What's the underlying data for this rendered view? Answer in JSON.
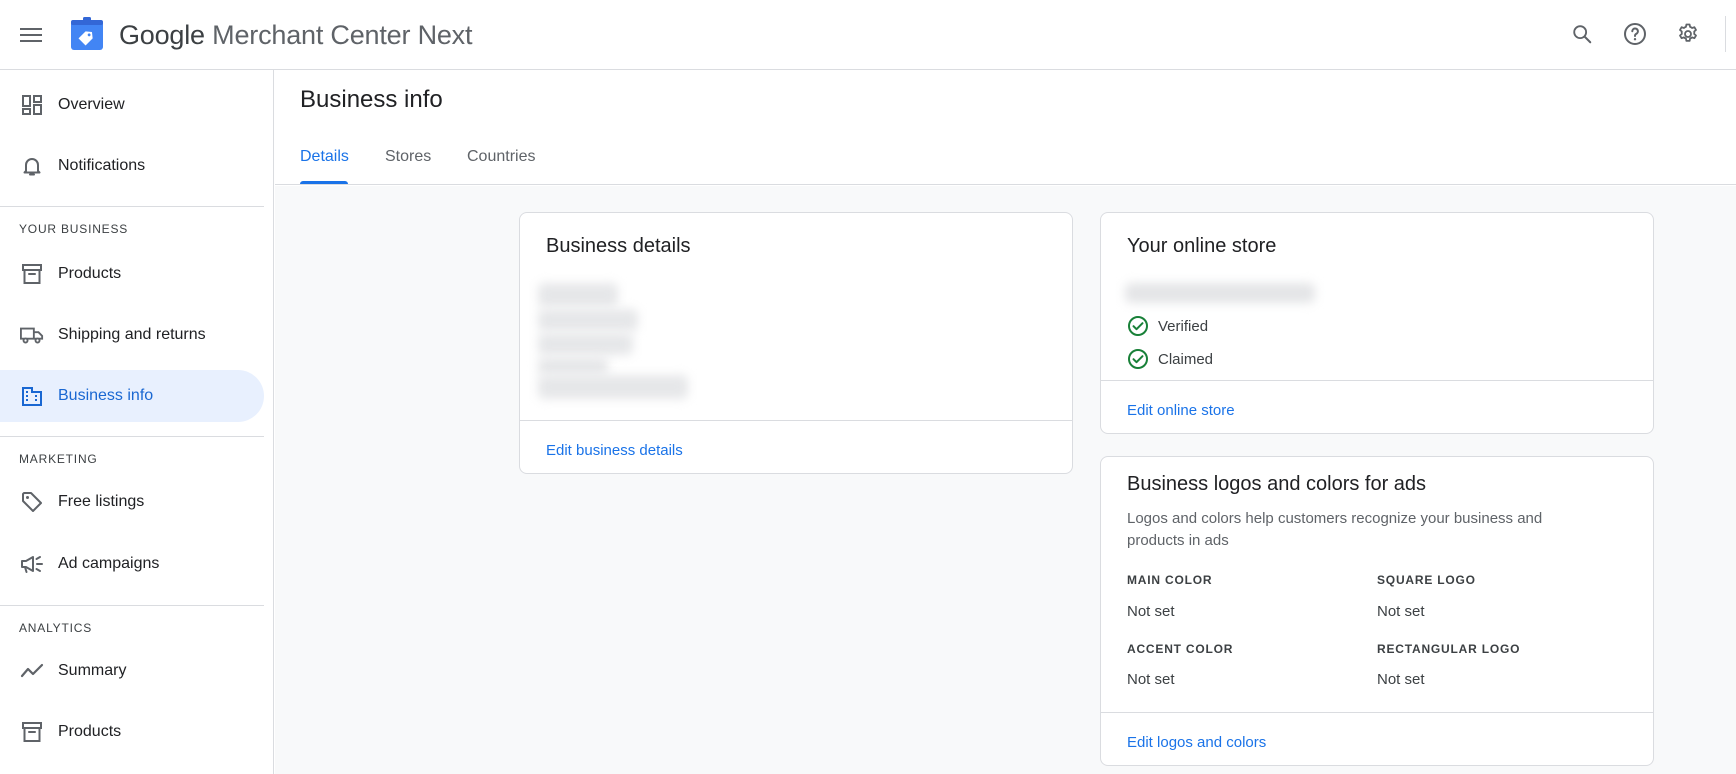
{
  "app": {
    "brand_google": "Google",
    "brand_rest": " Merchant Center Next"
  },
  "topbar": {
    "icons": [
      "menu-icon",
      "search-icon",
      "help-icon",
      "settings-icon"
    ]
  },
  "sidebar": {
    "items": [
      {
        "label": "Overview",
        "icon": "dashboard-icon"
      },
      {
        "label": "Notifications",
        "icon": "bell-icon"
      },
      {
        "label": "Products",
        "icon": "archive-icon"
      },
      {
        "label": "Shipping and returns",
        "icon": "truck-icon"
      },
      {
        "label": "Business info",
        "icon": "building-icon",
        "active": true
      },
      {
        "label": "Free listings",
        "icon": "tag-icon"
      },
      {
        "label": "Ad campaigns",
        "icon": "megaphone-icon"
      },
      {
        "label": "Summary",
        "icon": "trending-icon"
      },
      {
        "label": "Products",
        "icon": "archive-icon"
      }
    ],
    "sections": {
      "your_business": "YOUR BUSINESS",
      "marketing": "MARKETING",
      "analytics": "ANALYTICS"
    }
  },
  "page": {
    "title": "Business info",
    "tabs": [
      {
        "label": "Details",
        "active": true
      },
      {
        "label": "Stores"
      },
      {
        "label": "Countries"
      }
    ]
  },
  "business_details": {
    "title": "Business details",
    "edit_link": "Edit business details"
  },
  "online_store": {
    "title": "Your online store",
    "statuses": [
      "Verified",
      "Claimed"
    ],
    "edit_link": "Edit online store"
  },
  "logos_colors": {
    "title": "Business logos and colors for ads",
    "description": "Logos and colors help customers recognize your business and products in ads",
    "fields": [
      {
        "label": "MAIN COLOR",
        "value": "Not set"
      },
      {
        "label": "SQUARE LOGO",
        "value": "Not set"
      },
      {
        "label": "ACCENT COLOR",
        "value": "Not set"
      },
      {
        "label": "RECTANGULAR LOGO",
        "value": "Not set"
      }
    ],
    "edit_link": "Edit logos and colors"
  },
  "colors": {
    "accent": "#1a73e8",
    "active_nav_bg": "#e8f0fe",
    "verified_green": "#188038",
    "logo_blue": "#4285f4"
  }
}
